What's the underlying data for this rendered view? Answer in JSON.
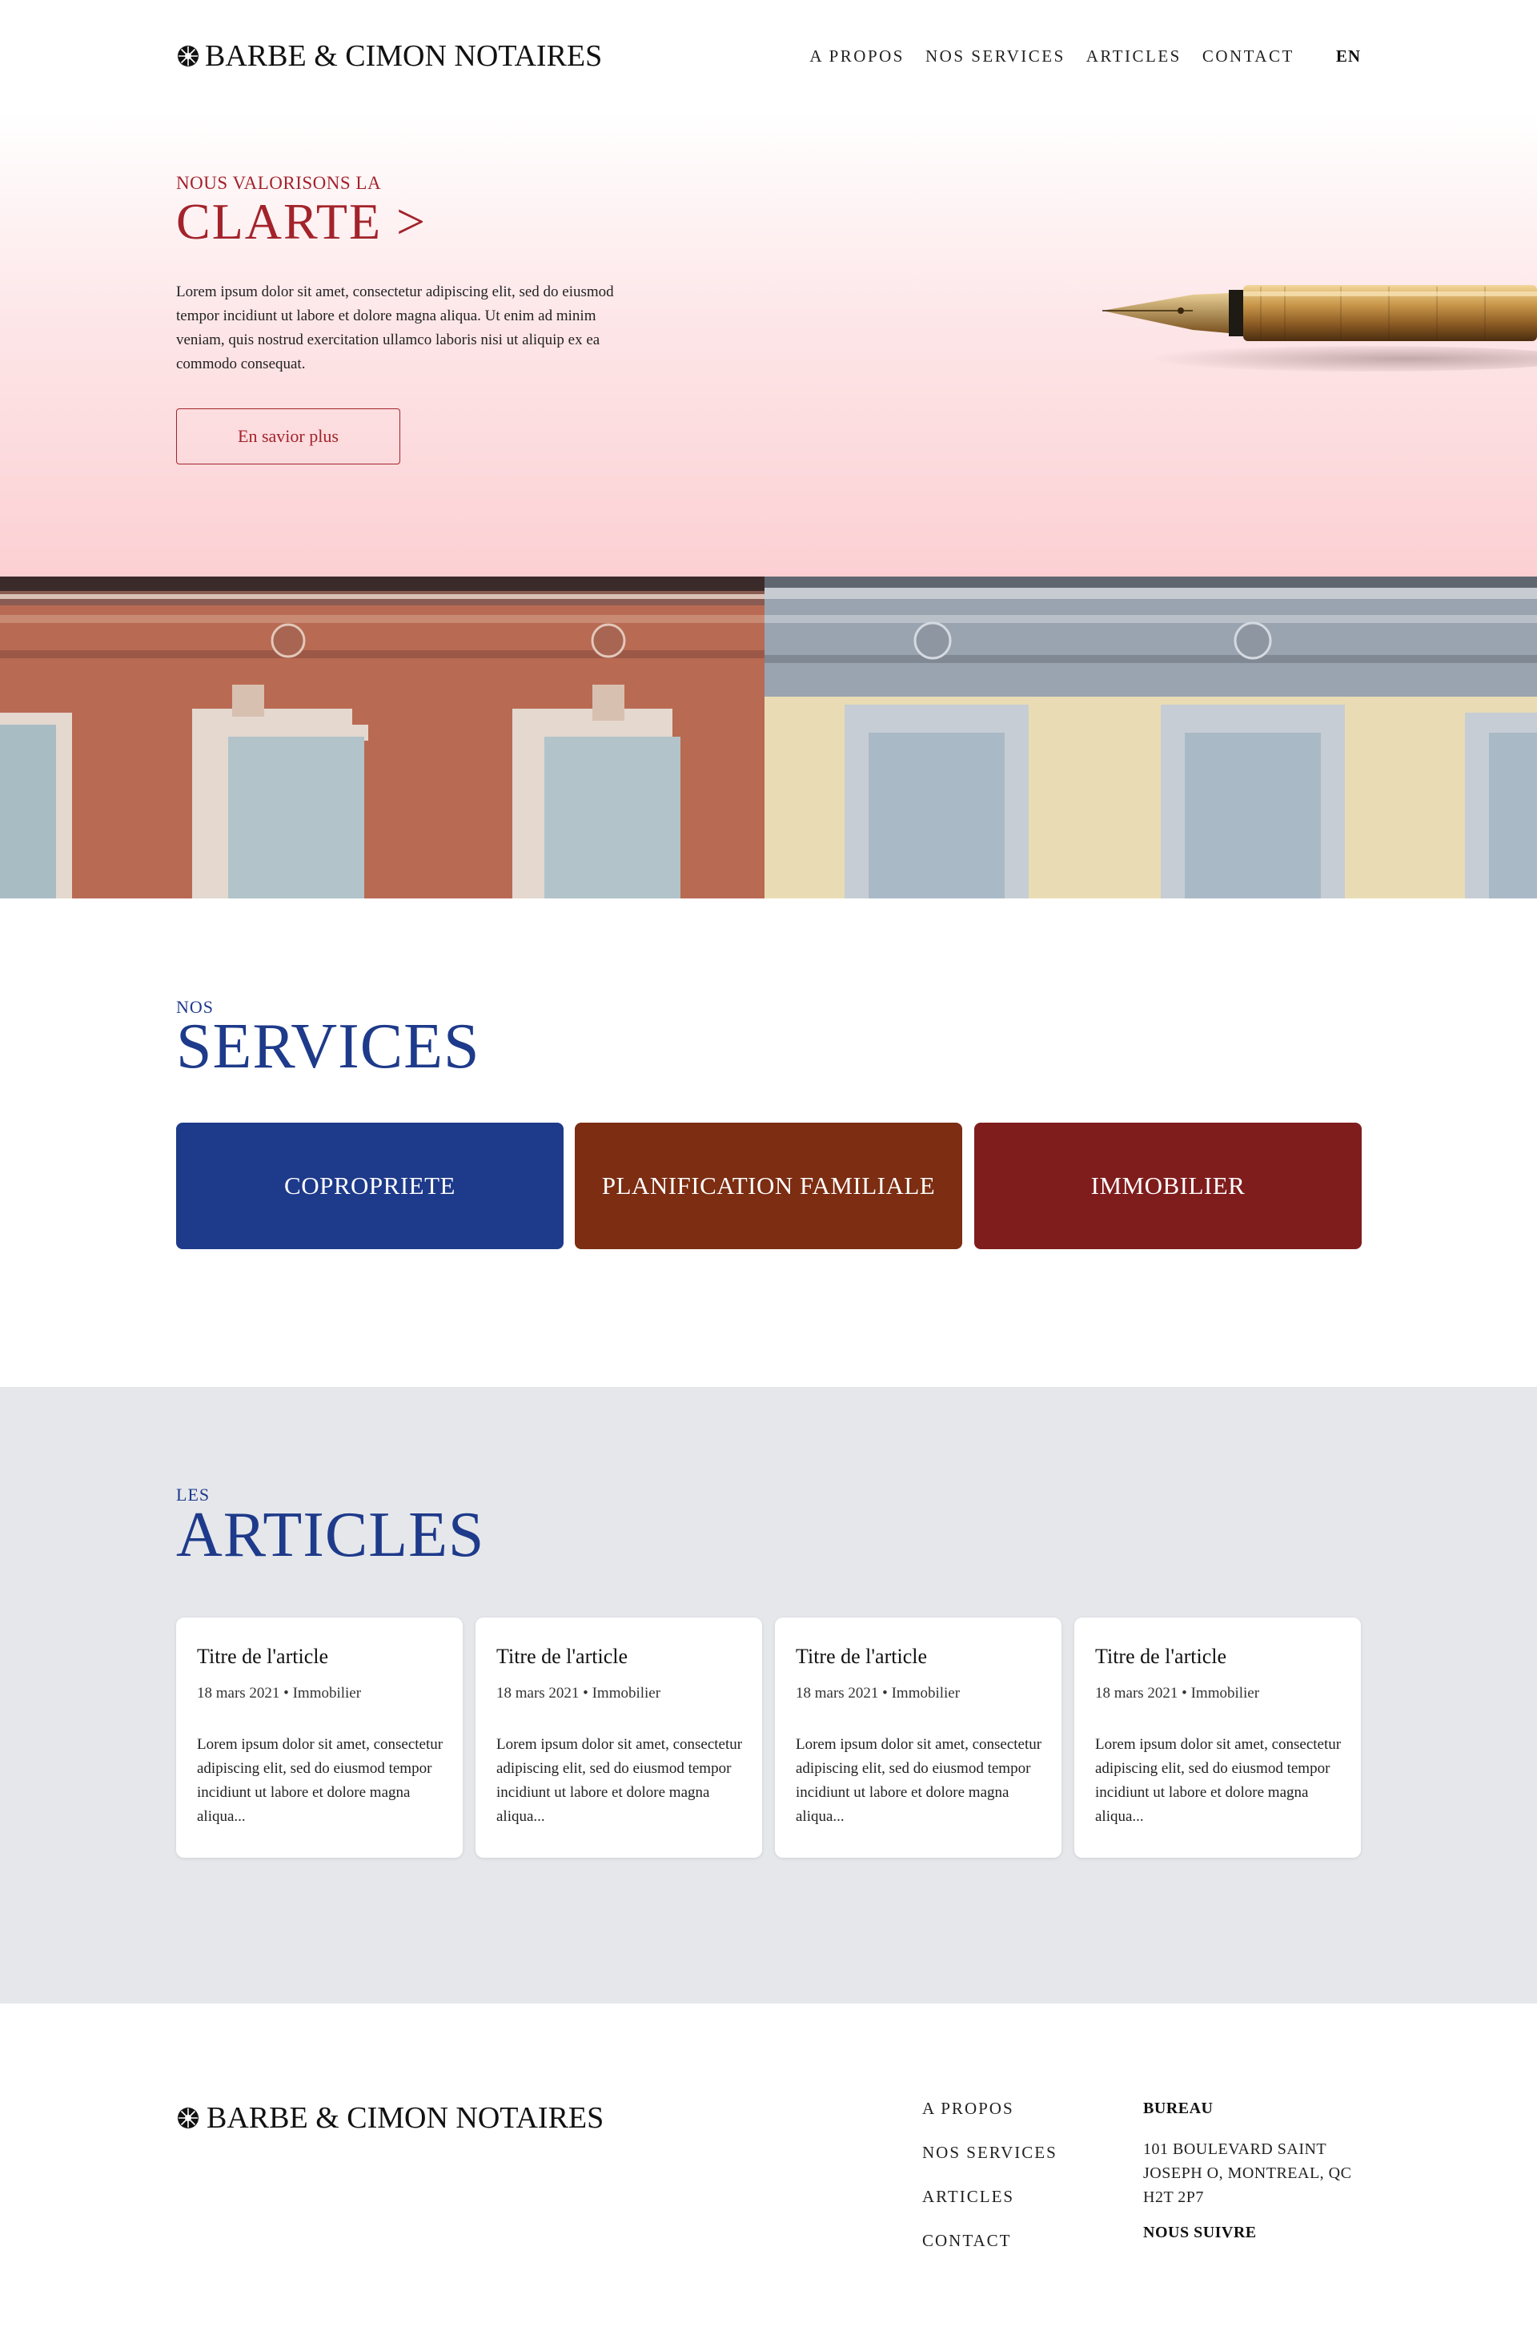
{
  "header": {
    "logo_text": "BARBE & CIMON NOTAIRES",
    "nav": [
      "A PROPOS",
      "NOS SERVICES",
      "ARTICLES",
      "CONTACT"
    ],
    "lang": "EN"
  },
  "hero": {
    "kicker": "NOUS VALORISONS LA",
    "title": "CLARTE >",
    "body": "Lorem ipsum dolor sit amet, consectetur adipiscing elit, sed do eiusmod tempor incidiunt ut labore et dolore magna aliqua. Ut enim ad minim veniam, quis nostrud exercitation ullamco laboris nisi ut aliquip ex ea commodo consequat.",
    "button": "En savior plus"
  },
  "services": {
    "kicker": "NOS",
    "title": "SERVICES",
    "items": [
      {
        "label": "COPROPRIETE",
        "color": "#1e3a8a"
      },
      {
        "label": "PLANIFICATION FAMILIALE",
        "color": "#7c2d12"
      },
      {
        "label": "IMMOBILIER",
        "color": "#7f1d1d"
      }
    ]
  },
  "articles": {
    "kicker": "LES",
    "title": "ARTICLES",
    "items": [
      {
        "title": "Titre de l'article",
        "meta": "18 mars 2021 • Immobilier",
        "excerpt": "Lorem ipsum dolor sit amet, consectetur adipiscing elit, sed do eiusmod tempor incidiunt ut labore et dolore magna aliqua..."
      },
      {
        "title": "Titre de l'article",
        "meta": "18 mars 2021 • Immobilier",
        "excerpt": "Lorem ipsum dolor sit amet, consectetur adipiscing elit, sed do eiusmod tempor incidiunt ut labore et dolore magna aliqua..."
      },
      {
        "title": "Titre de l'article",
        "meta": "18 mars 2021 • Immobilier",
        "excerpt": "Lorem ipsum dolor sit amet, consectetur adipiscing elit, sed do eiusmod tempor incidiunt ut labore et dolore magna aliqua..."
      },
      {
        "title": "Titre de l'article",
        "meta": "18 mars 2021 • Immobilier",
        "excerpt": "Lorem ipsum dolor sit amet, consectetur adipiscing elit, sed do eiusmod tempor incidiunt ut labore et dolore magna aliqua..."
      }
    ]
  },
  "footer": {
    "logo_text": "BARBE & CIMON NOTAIRES",
    "links": [
      "A PROPOS",
      "NOS SERVICES",
      "ARTICLES",
      "CONTACT"
    ],
    "office_heading": "BUREAU",
    "address": "101 BOULEVARD SAINT JOSEPH O, MONTREAL, QC H2T 2P7",
    "follow_heading": "NOUS SUIVRE"
  },
  "colors": {
    "brand_red": "#a3232b",
    "brand_blue": "#1e3a8a",
    "articles_bg": "#e5e7eb"
  }
}
